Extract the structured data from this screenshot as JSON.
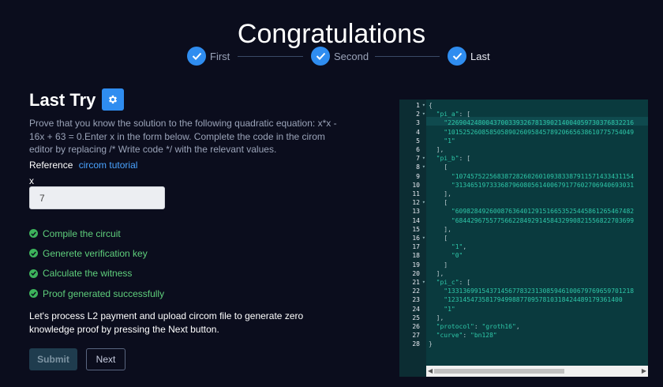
{
  "page": {
    "title": "Congratulations"
  },
  "stepper": {
    "steps": [
      {
        "label": "First"
      },
      {
        "label": "Second"
      },
      {
        "label": "Last"
      }
    ]
  },
  "task": {
    "heading": "Last Try",
    "description": "Prove that you know the solution to the following quadratic equation: x*x - 16x + 63 = 0.Enter x in the form below. Complete the code in the cirom editor by replacing /* Write code */ with the relevant values.",
    "reference_label": "Reference",
    "reference_link": "circom tutorial",
    "x_label": "x",
    "x_value": "7"
  },
  "status": {
    "items": [
      "Compile the circuit",
      "Generete verification key",
      "Calculate the witness",
      "Proof generated successfully"
    ]
  },
  "notice": "Let's process L2 payment and upload circom file to generate zero knowledge proof by pressing the Next button.",
  "buttons": {
    "submit": "Submit",
    "next": "Next"
  },
  "editor": {
    "lines": [
      {
        "n": "1",
        "fold": true,
        "text": "{"
      },
      {
        "n": "2",
        "fold": true,
        "text": "  \"pi_a\": ["
      },
      {
        "n": "3",
        "fold": false,
        "text": "    \"2269042480043700339326781390214004059730376832216"
      },
      {
        "n": "4",
        "fold": false,
        "text": "    \"1015252608585058902609584578920665638610775754049"
      },
      {
        "n": "5",
        "fold": false,
        "text": "    \"1\""
      },
      {
        "n": "6",
        "fold": false,
        "text": "  ],"
      },
      {
        "n": "7",
        "fold": true,
        "text": "  \"pi_b\": ["
      },
      {
        "n": "8",
        "fold": true,
        "text": "    ["
      },
      {
        "n": "9",
        "fold": false,
        "text": "      \"10745752256838728260260109383387911571433431154"
      },
      {
        "n": "10",
        "fold": false,
        "text": "      \"31346519733368796080561400679177602706940693031"
      },
      {
        "n": "11",
        "fold": false,
        "text": "    ],"
      },
      {
        "n": "12",
        "fold": true,
        "text": "    ["
      },
      {
        "n": "13",
        "fold": false,
        "text": "      \"60982849260087636401291516653525445861265467482"
      },
      {
        "n": "14",
        "fold": false,
        "text": "      \"68442967557756622849291458432990821556822703699"
      },
      {
        "n": "15",
        "fold": false,
        "text": "    ],"
      },
      {
        "n": "16",
        "fold": true,
        "text": "    ["
      },
      {
        "n": "17",
        "fold": false,
        "text": "      \"1\","
      },
      {
        "n": "18",
        "fold": false,
        "text": "      \"0\""
      },
      {
        "n": "19",
        "fold": false,
        "text": "    ]"
      },
      {
        "n": "20",
        "fold": false,
        "text": "  ],"
      },
      {
        "n": "21",
        "fold": true,
        "text": "  \"pi_c\": ["
      },
      {
        "n": "22",
        "fold": false,
        "text": "    \"1331369915437145677832313085946100679769659701218"
      },
      {
        "n": "23",
        "fold": false,
        "text": "    \"1231454735817949988770957810318424489179361400"
      },
      {
        "n": "24",
        "fold": false,
        "text": "    \"1\""
      },
      {
        "n": "25",
        "fold": false,
        "text": "  ],"
      },
      {
        "n": "26",
        "fold": false,
        "text": "  \"protocol\": \"groth16\","
      },
      {
        "n": "27",
        "fold": false,
        "text": "  \"curve\": \"bn128\""
      },
      {
        "n": "28",
        "fold": false,
        "text": "}"
      }
    ]
  },
  "colors": {
    "background": "#0b0d1d",
    "accent": "#2f8df0",
    "success": "#3db35c",
    "editor_bg": "#0a3a3e",
    "string": "#2ec7a8"
  }
}
